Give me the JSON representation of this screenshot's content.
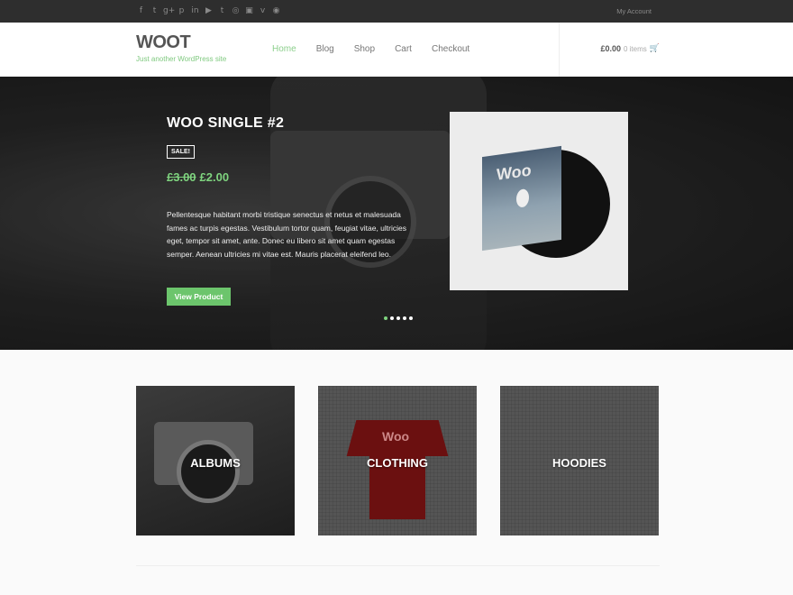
{
  "topbar": {
    "social_icons": [
      "facebook-icon",
      "twitter-icon",
      "google-plus-icon",
      "pinterest-icon",
      "linkedin-icon",
      "youtube-icon",
      "tumblr-icon",
      "instagram-icon",
      "flickr-icon",
      "vimeo-icon",
      "rss-icon"
    ],
    "social_glyphs": [
      "f",
      "t",
      "g+",
      "p",
      "in",
      "▶",
      "t",
      "◎",
      "▣",
      "v",
      "◉"
    ],
    "my_account": "My Account"
  },
  "header": {
    "logo": "WOOT",
    "tagline": "Just another WordPress site",
    "nav": [
      "Home",
      "Blog",
      "Shop",
      "Cart",
      "Checkout"
    ],
    "active_nav": "Home",
    "cart_amount": "£0.00",
    "cart_items": "0 items"
  },
  "hero": {
    "title": "WOO SINGLE #2",
    "badge": "SALE!",
    "old_price": "£3.00",
    "new_price": "£2.00",
    "description": "Pellentesque habitant morbi tristique senectus et netus et malesuada fames ac turpis egestas. Vestibulum tortor quam, feugiat vitae, ultricies eget, tempor sit amet, ante. Donec eu libero sit amet quam egestas semper. Aenean ultricies mi vitae est. Mauris placerat eleifend leo.",
    "button": "View Product",
    "product_art_text": "Woo",
    "slides": 5,
    "active_slide": 1
  },
  "categories": [
    {
      "label": "ALBUMS"
    },
    {
      "label": "CLOTHING"
    },
    {
      "label": "HOODIES"
    }
  ],
  "colors": {
    "accent": "#6cc56c",
    "topbar": "#2e2e2e"
  }
}
